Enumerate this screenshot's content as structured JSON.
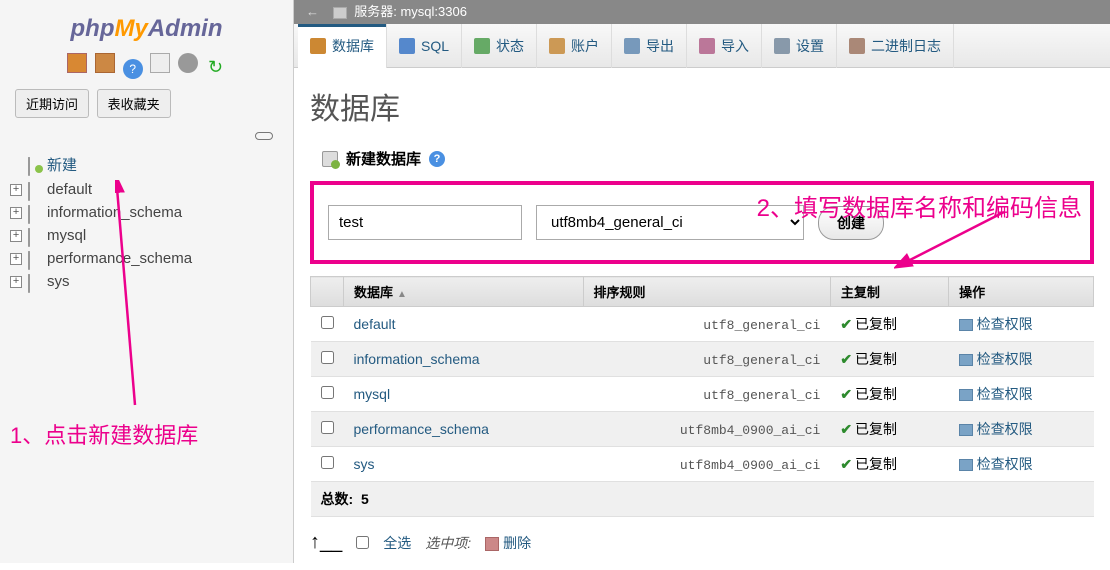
{
  "logo": {
    "php": "php",
    "my": "My",
    "admin": "Admin"
  },
  "sidebar": {
    "tabs": [
      {
        "label": "近期访问"
      },
      {
        "label": "表收藏夹"
      }
    ],
    "new_label": "新建",
    "tree": [
      {
        "label": "default"
      },
      {
        "label": "information_schema"
      },
      {
        "label": "mysql"
      },
      {
        "label": "performance_schema"
      },
      {
        "label": "sys"
      }
    ]
  },
  "topbar": {
    "server_label": "服务器: mysql:3306"
  },
  "menu": [
    {
      "label": "数据库"
    },
    {
      "label": "SQL"
    },
    {
      "label": "状态"
    },
    {
      "label": "账户"
    },
    {
      "label": "导出"
    },
    {
      "label": "导入"
    },
    {
      "label": "设置"
    },
    {
      "label": "二进制日志"
    }
  ],
  "page": {
    "title": "数据库",
    "create_header": "新建数据库",
    "db_name_value": "test",
    "collation_value": "utf8mb4_general_ci",
    "create_btn": "创建"
  },
  "table": {
    "headers": [
      {
        "label": "数据库"
      },
      {
        "label": "排序规则"
      },
      {
        "label": "主复制"
      },
      {
        "label": "操作"
      }
    ],
    "rows": [
      {
        "name": "default",
        "collation": "utf8_general_ci",
        "replicated": "已复制",
        "action": "检查权限"
      },
      {
        "name": "information_schema",
        "collation": "utf8_general_ci",
        "replicated": "已复制",
        "action": "检查权限"
      },
      {
        "name": "mysql",
        "collation": "utf8_general_ci",
        "replicated": "已复制",
        "action": "检查权限"
      },
      {
        "name": "performance_schema",
        "collation": "utf8mb4_0900_ai_ci",
        "replicated": "已复制",
        "action": "检查权限"
      },
      {
        "name": "sys",
        "collation": "utf8mb4_0900_ai_ci",
        "replicated": "已复制",
        "action": "检查权限"
      }
    ],
    "total_label": "总数:",
    "total_count": "5"
  },
  "select_all": {
    "label": "全选",
    "with_selected": "选中项:",
    "delete": "删除"
  },
  "annotations": {
    "step1": "1、点击新建数据库",
    "step2": "2、填写数据库名称和编码信息"
  }
}
